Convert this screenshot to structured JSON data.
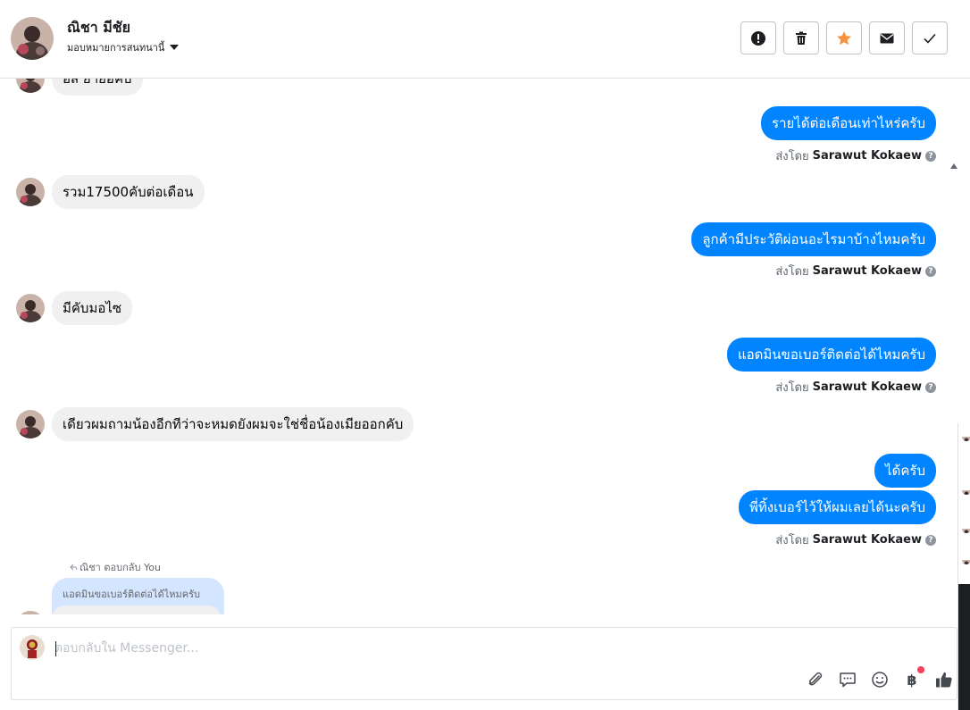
{
  "header": {
    "contact_name": "ณิชา มีชัย",
    "assign_label": "มอบหมายการสนทนานี้",
    "actions": [
      "spam-icon",
      "trash-icon",
      "star-icon",
      "envelope-icon",
      "check-icon"
    ],
    "star_color": "#f7923b"
  },
  "conversation": {
    "partial_top_text": "อิส ย้ายอิคับ",
    "messages": [
      {
        "dir": "out",
        "text": "รายได้ต่อเดือนเท่าไหร่ครับ"
      },
      {
        "dir": "in",
        "text": "รวม17500คับต่อเดือน"
      },
      {
        "dir": "out",
        "text": "ลูกค้ามีประวัติผ่อนอะไรมาบ้างไหมครับ"
      },
      {
        "dir": "in",
        "text": "มีคับมอไซ"
      },
      {
        "dir": "out",
        "text": "แอดมินขอเบอร์ติดต่อได้ไหมครับ"
      },
      {
        "dir": "in",
        "text": "เดียวผมถามน้องอีกทีว่าจะหมดยังผมจะใช่ชื่อน้องเมียออกคับ"
      },
      {
        "dir": "out",
        "text": "ได้ครับ"
      },
      {
        "dir": "out",
        "text": "พี่ทิ้งเบอร์ไว้ให้ผมเลยได้นะครับ"
      }
    ],
    "sent_by_prefix": "ส่งโดย",
    "sent_by_name": "Sarawut Kokaew",
    "help_glyph": "?",
    "reply_label": "ณิชา ตอบกลับ You",
    "reply_quote": "แอดมินขอเบอร์ติดต่อได้ไหมครับ",
    "outgoing_color": "#0084ff",
    "incoming_color": "#f0f0f0"
  },
  "composer": {
    "placeholder": "ตอบกลับใน Messenger...",
    "value": "",
    "tools": [
      "attach-icon",
      "saved-reply-icon",
      "emoji-icon",
      "payment-icon",
      "like-icon"
    ],
    "payment_glyph": "฿"
  }
}
